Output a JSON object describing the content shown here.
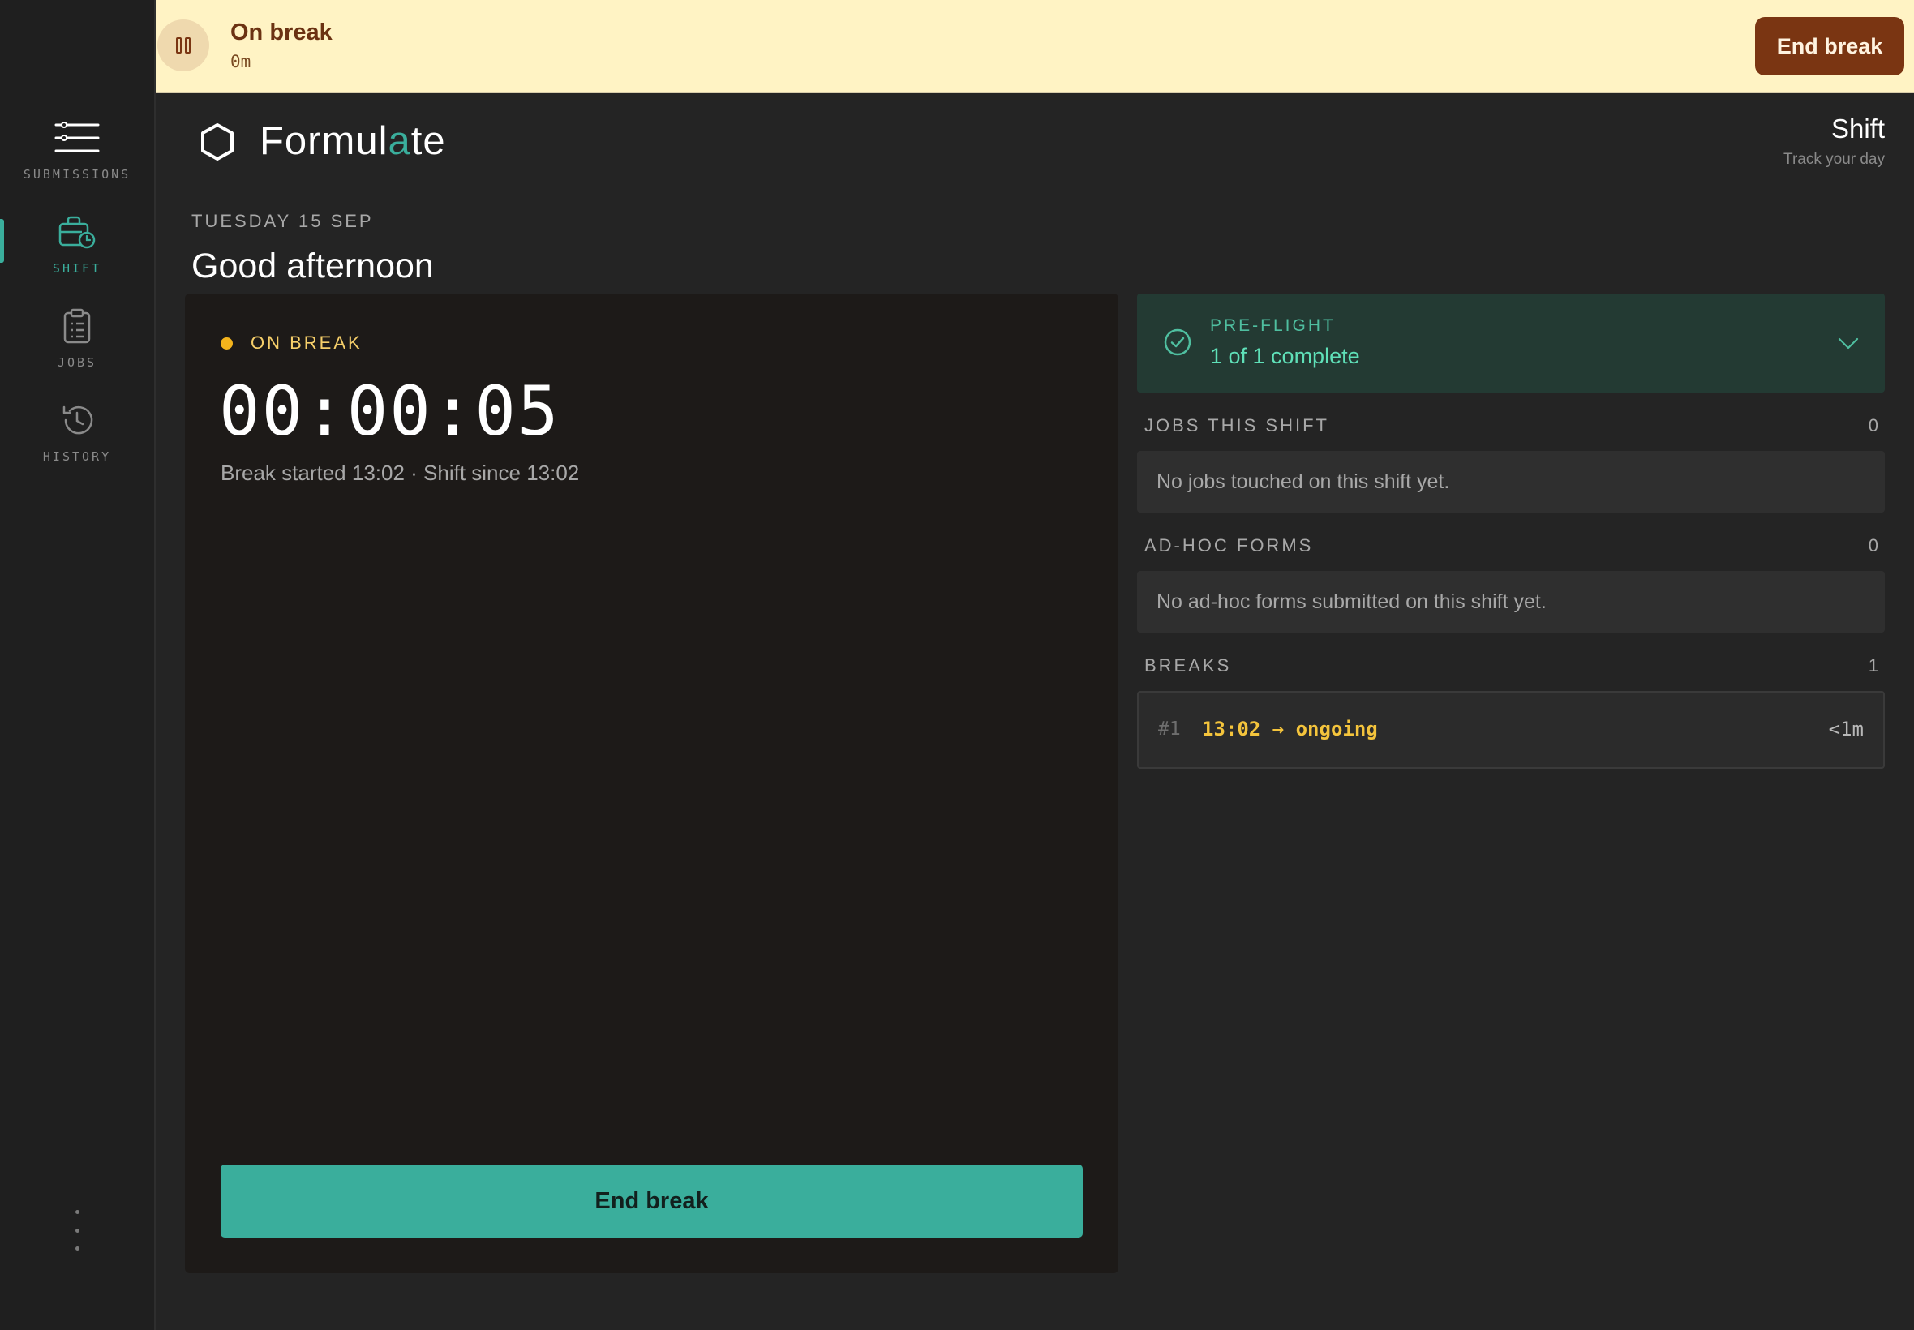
{
  "sidebar": {
    "items": [
      {
        "key": "submissions",
        "label": "SUBMISSIONS",
        "icon": "sliders-icon",
        "active": false
      },
      {
        "key": "shift",
        "label": "SHIFT",
        "icon": "briefcase-clock-icon",
        "active": true
      },
      {
        "key": "jobs",
        "label": "JOBS",
        "icon": "clipboard-list-icon",
        "active": false
      },
      {
        "key": "history",
        "label": "HISTORY",
        "icon": "history-icon",
        "active": false
      }
    ],
    "more_icon": "vertical-ellipsis-icon"
  },
  "banner": {
    "icon": "pause-icon",
    "title": "On break",
    "elapsed": "0m",
    "button_label": "End break"
  },
  "header": {
    "logo_icon": "hexagon-icon",
    "logo_prefix": "Formul",
    "logo_accent": "a",
    "logo_suffix": "te",
    "page_title": "Shift",
    "page_subtitle": "Track your day"
  },
  "greeting": {
    "date": "TUESDAY 15 SEP",
    "text": "Good afternoon"
  },
  "timer_card": {
    "status_label": "ON BREAK",
    "timer": "00:00:05",
    "meta": "Break started 13:02 · Shift since 13:02",
    "button_label": "End break"
  },
  "preflight": {
    "label": "PRE-FLIGHT",
    "status": "1 of 1 complete",
    "icon": "check-circle-icon",
    "chevron_icon": "chevron-down-icon"
  },
  "sections": {
    "jobs": {
      "title": "JOBS THIS SHIFT",
      "count": "0",
      "empty": "No jobs touched on this shift yet."
    },
    "adhoc": {
      "title": "AD-HOC FORMS",
      "count": "0",
      "empty": "No ad-hoc forms submitted on this shift yet."
    },
    "breaks": {
      "title": "BREAKS",
      "count": "1",
      "rows": [
        {
          "index": "#1",
          "range": "13:02 → ongoing",
          "duration": "<1m"
        }
      ]
    }
  },
  "colors": {
    "accent": "#3aae9c",
    "banner_bg": "#fff3c4",
    "banner_button": "#7a3512",
    "break_status": "#f4b41c"
  }
}
